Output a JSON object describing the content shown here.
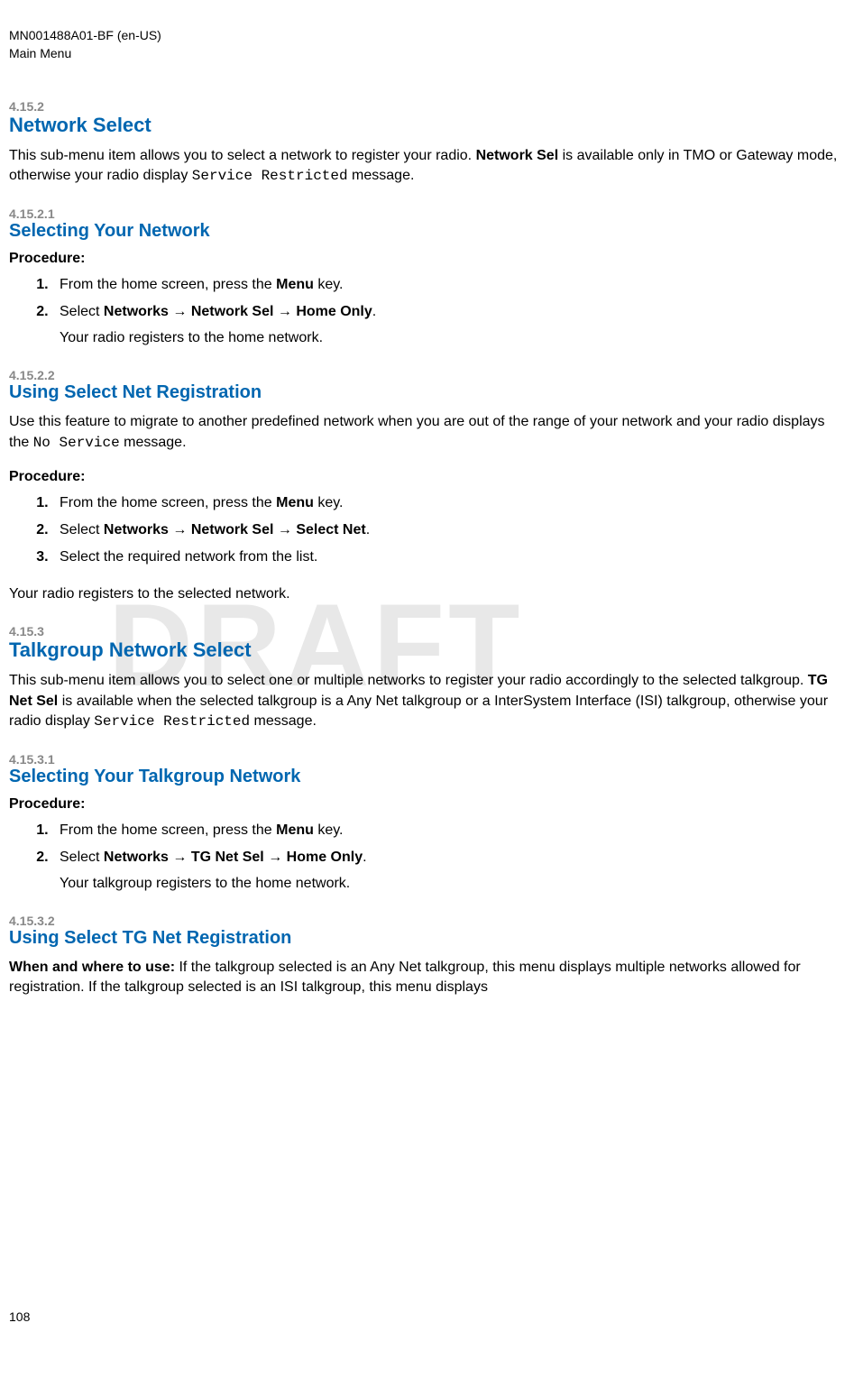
{
  "header": {
    "doc_id": "MN001488A01-BF (en-US)",
    "section": "Main Menu"
  },
  "watermark": "DRAFT",
  "page_number": "108",
  "sections": {
    "s4_15_2": {
      "num": "4.15.2",
      "title": "Network Select",
      "body_pre": "This sub-menu item allows you to select a network to register your radio. ",
      "body_bold": "Network Sel",
      "body_mid": " is available only in TMO or Gateway mode, otherwise your radio display ",
      "body_code": "Service Restricted",
      "body_post": " message."
    },
    "s4_15_2_1": {
      "num": "4.15.2.1",
      "title": "Selecting Your Network",
      "procedure_label": "Procedure:",
      "step1_pre": "From the home screen, press the ",
      "step1_bold": "Menu",
      "step1_post": " key.",
      "step2_pre": "Select ",
      "step2_bold": "Networks → Network Sel → Home Only",
      "step2_post": ".",
      "step2_sub": "Your radio registers to the home network."
    },
    "s4_15_2_2": {
      "num": "4.15.2.2",
      "title": "Using Select Net Registration",
      "body_pre": "Use this feature to migrate to another predefined network when you are out of the range of your network and your radio displays the ",
      "body_code": "No Service",
      "body_post": " message.",
      "procedure_label": "Procedure:",
      "step1_pre": "From the home screen, press the ",
      "step1_bold": "Menu",
      "step1_post": " key.",
      "step2_pre": "Select ",
      "step2_bold": "Networks → Network Sel → Select Net",
      "step2_post": ".",
      "step3": "Select the required network from the list.",
      "result": "Your radio registers to the selected network."
    },
    "s4_15_3": {
      "num": "4.15.3",
      "title": "Talkgroup Network Select",
      "body_pre": "This sub-menu item allows you to select one or multiple networks to register your radio accordingly to the selected talkgroup. ",
      "body_bold": "TG Net Sel",
      "body_mid": " is available when the selected talkgroup is a Any Net talkgroup or a InterSystem Interface (ISI) talkgroup, otherwise your radio display ",
      "body_code": "Service Restricted",
      "body_post": " message."
    },
    "s4_15_3_1": {
      "num": "4.15.3.1",
      "title": "Selecting Your Talkgroup Network",
      "procedure_label": "Procedure:",
      "step1_pre": "From the home screen, press the ",
      "step1_bold": "Menu",
      "step1_post": " key.",
      "step2_pre": "Select ",
      "step2_bold": "Networks → TG Net Sel → Home Only",
      "step2_post": ".",
      "step2_sub": "Your talkgroup registers to the home network."
    },
    "s4_15_3_2": {
      "num": "4.15.3.2",
      "title": "Using Select TG Net Registration",
      "when_bold": "When and where to use:",
      "when_text": " If the talkgroup selected is an Any Net talkgroup, this menu displays multiple networks allowed for registration. If the talkgroup selected is an ISI talkgroup, this menu displays"
    }
  }
}
